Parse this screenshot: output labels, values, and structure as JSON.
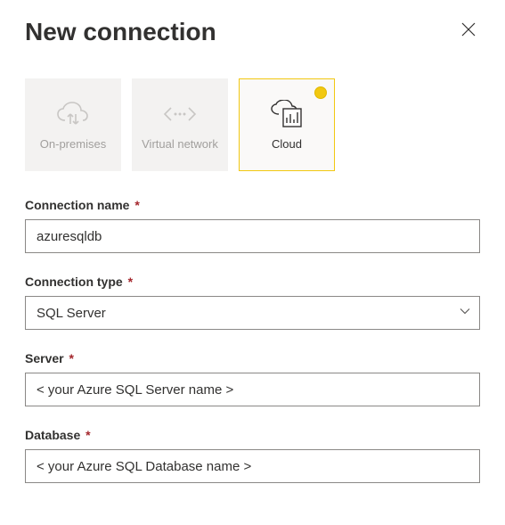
{
  "header": {
    "title": "New connection"
  },
  "tiles": {
    "onprem": {
      "label": "On-premises",
      "icon": "cloud-sync-icon"
    },
    "vnet": {
      "label": "Virtual network",
      "icon": "virtual-network-icon"
    },
    "cloud": {
      "label": "Cloud",
      "icon": "cloud-report-icon"
    }
  },
  "fields": {
    "connection_name": {
      "label": "Connection name",
      "value": "azuresqldb"
    },
    "connection_type": {
      "label": "Connection type",
      "value": "SQL Server"
    },
    "server": {
      "label": "Server",
      "value": "< your Azure SQL Server name >"
    },
    "database": {
      "label": "Database",
      "value": "< your Azure SQL Database name >"
    }
  },
  "required_marker": "*"
}
